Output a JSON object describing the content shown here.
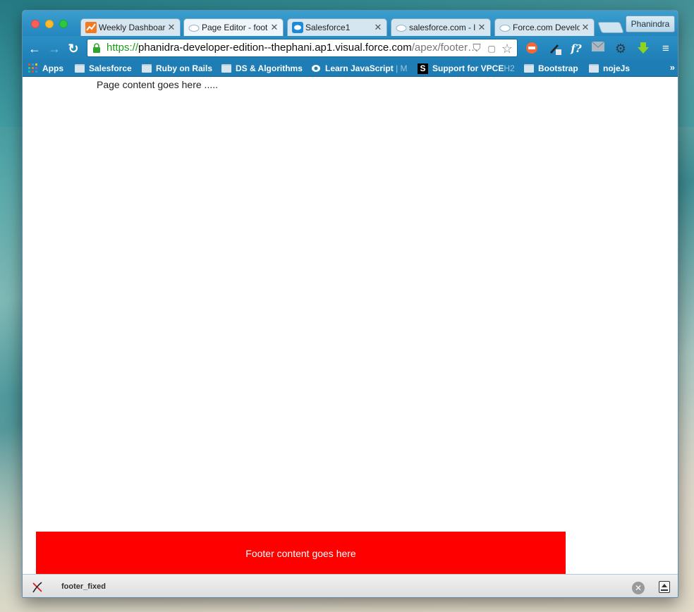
{
  "window": {
    "profile_name": "Phanindra"
  },
  "tabs": [
    {
      "title": "Weekly Dashboard",
      "icon": "chart-icon",
      "active": false
    },
    {
      "title": "Page Editor - foot",
      "icon": "cloud-icon",
      "active": true
    },
    {
      "title": "Salesforce1",
      "icon": "salesforce-icon",
      "active": false
    },
    {
      "title": "salesforce.com - l",
      "icon": "cloud-icon",
      "active": false
    },
    {
      "title": "Force.com Develo",
      "icon": "cloud-icon",
      "active": false
    }
  ],
  "toolbar": {
    "url_scheme": "https://",
    "url_host": "phanidra-developer-edition--thephani.ap1.visual.force.com",
    "url_path": "/apex/footer…"
  },
  "bookmarks": [
    {
      "label": "Apps",
      "icon": "apps-grid-icon"
    },
    {
      "label": "Salesforce",
      "icon": "folder-icon"
    },
    {
      "label": "Ruby on Rails",
      "icon": "folder-icon"
    },
    {
      "label": "DS & Algorithms",
      "icon": "folder-icon"
    },
    {
      "label": "Learn JavaScript",
      "suffix": "| M",
      "icon": "learn-icon"
    },
    {
      "label": "Support for VPCE",
      "suffix": "H2",
      "icon": "s-logo-icon"
    },
    {
      "label": "Bootstrap",
      "icon": "folder-icon"
    },
    {
      "label": "nojeJs",
      "icon": "folder-icon"
    }
  ],
  "page": {
    "content_text": "Page content goes here .....",
    "footer_text": "Footer content goes here",
    "footer_color": "#ff0000"
  },
  "statusbar": {
    "label": "footer_fixed"
  }
}
